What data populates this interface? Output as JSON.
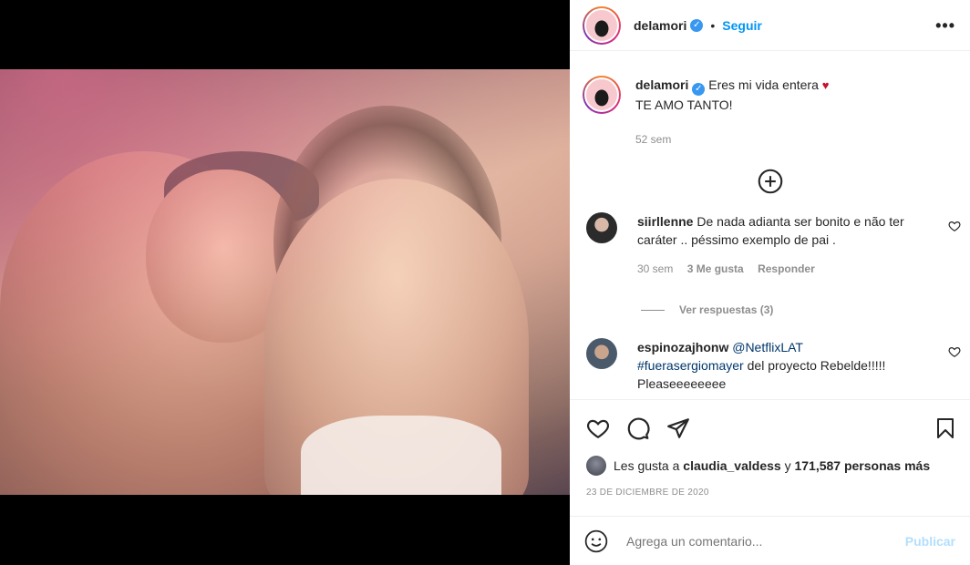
{
  "post": {
    "username": "delamori",
    "follow_label": "Seguir",
    "dot": "•",
    "more_label": "•••"
  },
  "caption": {
    "username": "delamori",
    "text_line1": "Eres mi vida entera",
    "heart": "♥",
    "text_line2": "TE AMO TANTO!",
    "time": "52 sem"
  },
  "comments": [
    {
      "username": "siirllenne",
      "text": "De nada adianta ser bonito e não ter caráter .. péssimo exemplo de pai .",
      "time": "30 sem",
      "likes": "3 Me gusta",
      "reply": "Responder",
      "view_replies": "Ver respuestas (3)"
    },
    {
      "username": "espinozajhonw",
      "mention": "@NetflixLAT",
      "hashtag": "#fuerasergiomayer",
      "text": "del proyecto Rebelde!!!!!",
      "text2": "Pleaseeeeeeee"
    }
  ],
  "likes_summary": {
    "prefix": "Les gusta a",
    "user": "claudia_valdess",
    "conj": "y",
    "count": "171,587 personas más"
  },
  "date": "23 DE DICIEMBRE DE 2020",
  "comment_box": {
    "placeholder": "Agrega un comentario...",
    "publish_label": "Publicar"
  },
  "icons": [
    "verified-badge-icon",
    "more-options-icon",
    "add-comments-icon",
    "heart-icon",
    "comment-icon",
    "share-icon",
    "bookmark-icon",
    "emoji-icon"
  ],
  "colors": {
    "link": "#0095f6",
    "verified": "#3897f0",
    "heart": "#c4132b",
    "muted": "#8e8e8e",
    "publish_disabled": "#b2dffc"
  }
}
